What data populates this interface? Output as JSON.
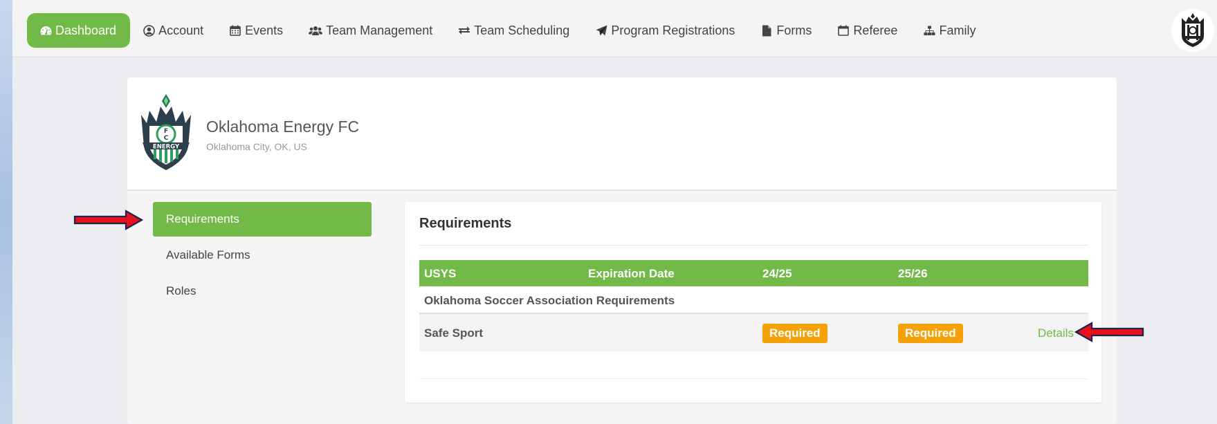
{
  "nav": {
    "items": [
      {
        "label": "Dashboard",
        "icon": "dashboard-icon"
      },
      {
        "label": "Account",
        "icon": "user-circle-icon"
      },
      {
        "label": "Events",
        "icon": "calendar-icon"
      },
      {
        "label": "Team Management",
        "icon": "users-icon"
      },
      {
        "label": "Team Scheduling",
        "icon": "exchange-icon"
      },
      {
        "label": "Program Registrations",
        "icon": "paper-plane-icon"
      },
      {
        "label": "Forms",
        "icon": "file-icon"
      },
      {
        "label": "Referee",
        "icon": "calendar-outline-icon"
      },
      {
        "label": "Family",
        "icon": "sitemap-icon"
      }
    ],
    "active_color": "#72ba48"
  },
  "club": {
    "name": "Oklahoma Energy FC",
    "location": "Oklahoma City, OK, US",
    "logo_text": "FC ENERGY"
  },
  "sidebar": {
    "items": [
      {
        "label": "Requirements",
        "active": true
      },
      {
        "label": "Available Forms",
        "active": false
      },
      {
        "label": "Roles",
        "active": false
      }
    ]
  },
  "requirements": {
    "title": "Requirements",
    "columns": [
      "USYS",
      "Expiration Date",
      "24/25",
      "25/26"
    ],
    "groups": [
      {
        "name": "Oklahoma Soccer Association Requirements",
        "rows": [
          {
            "name": "Safe Sport",
            "expiration": "",
            "season_2425": "Required",
            "season_2526": "Required",
            "action": "Details"
          }
        ]
      }
    ]
  },
  "colors": {
    "brand_green": "#72ba48",
    "badge_orange": "#f5a209",
    "annotation_arrow": "#e8101a"
  }
}
